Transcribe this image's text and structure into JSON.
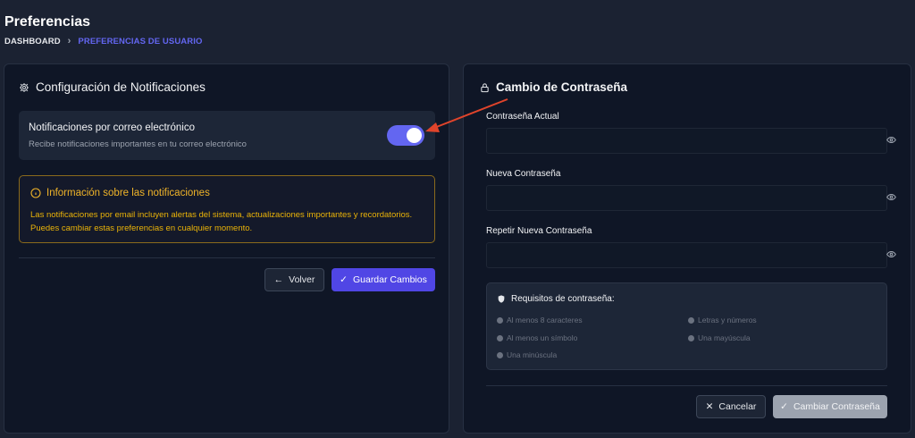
{
  "page": {
    "title": "Preferencias",
    "breadcrumb": {
      "root": "DASHBOARD",
      "current": "PREFERENCIAS DE USUARIO"
    }
  },
  "notifications_panel": {
    "heading": "Configuración de Notificaciones",
    "email_card": {
      "title": "Notificaciones por correo electrónico",
      "description": "Recibe notificaciones importantes en tu correo electrónico",
      "toggle_on": true
    },
    "info": {
      "title": "Información sobre las notificaciones",
      "line1": "Las notificaciones por email incluyen alertas del sistema, actualizaciones importantes y recordatorios.",
      "line2": "Puedes cambiar estas preferencias en cualquier momento."
    },
    "back_label": "Volver",
    "save_label": "Guardar Cambios"
  },
  "password_panel": {
    "heading": "Cambio de Contraseña",
    "current_label": "Contraseña Actual",
    "new_label": "Nueva Contraseña",
    "repeat_label": "Repetir Nueva Contraseña",
    "requirements": {
      "title": "Requisitos de contraseña:",
      "items": [
        "Al menos 8 caracteres",
        "Letras y números",
        "Al menos un símbolo",
        "Una mayúscula",
        "Una minúscula"
      ]
    },
    "cancel_label": "Cancelar",
    "change_label": "Cambiar Contraseña"
  },
  "colors": {
    "accent": "#5046e5",
    "warning": "#eab308",
    "annotation_arrow": "#e0442b"
  }
}
